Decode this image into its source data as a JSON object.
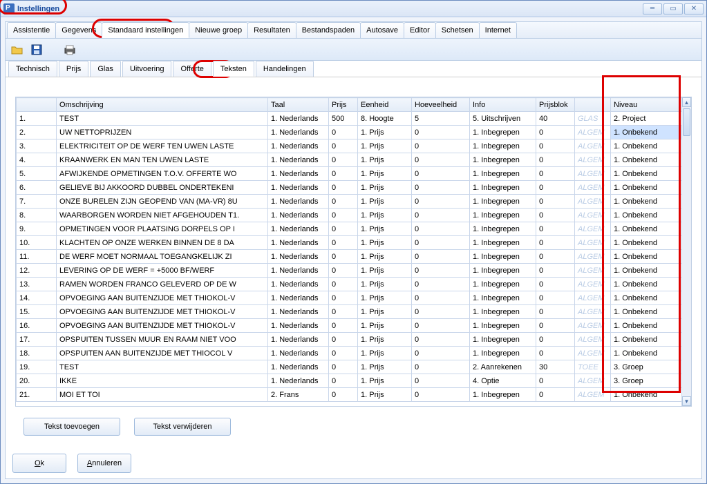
{
  "window": {
    "title": "Instellingen"
  },
  "main_tabs": [
    "Assistentie",
    "Gegevens",
    "Standaard instellingen",
    "Nieuwe groep",
    "Resultaten",
    "Bestandspaden",
    "Autosave",
    "Editor",
    "Schetsen",
    "Internet"
  ],
  "main_tabs_active_index": 2,
  "sub_tabs": [
    "Technisch",
    "Prijs",
    "Glas",
    "Uitvoering",
    "Offerte",
    "Teksten",
    "Handelingen"
  ],
  "sub_tabs_active_index": 5,
  "toolbar": {
    "open": "Open",
    "save": "Save",
    "print": "Print"
  },
  "columns": [
    "",
    "Omschrijving",
    "Taal",
    "Prijs",
    "Eenheid",
    "Hoeveelheid",
    "Info",
    "Prijsblok",
    "",
    "Niveau",
    ""
  ],
  "rows": [
    {
      "n": "1.",
      "desc": "TEST",
      "taal": "1. Nederlands",
      "prijs": "500",
      "eenh": "8. Hoogte",
      "hoev": "5",
      "info": "5. Uitschrijven",
      "pb": "40",
      "wm": "GLAS",
      "niv": "2. Project",
      "sel": false
    },
    {
      "n": "2.",
      "desc": "UW NETTOPRIJZEN",
      "taal": "1. Nederlands",
      "prijs": "0",
      "eenh": "1. Prijs",
      "hoev": "0",
      "info": "1. Inbegrepen",
      "pb": "0",
      "wm": "ALGEM",
      "niv": "1. Onbekend",
      "sel": true
    },
    {
      "n": "3.",
      "desc": "ELEKTRICITEIT OP DE WERF TEN UWEN LASTE",
      "taal": "1. Nederlands",
      "prijs": "0",
      "eenh": "1. Prijs",
      "hoev": "0",
      "info": "1. Inbegrepen",
      "pb": "0",
      "wm": "ALGEM",
      "niv": "1. Onbekend",
      "sel": false
    },
    {
      "n": "4.",
      "desc": "KRAANWERK EN MAN TEN UWEN LASTE",
      "taal": "1. Nederlands",
      "prijs": "0",
      "eenh": "1. Prijs",
      "hoev": "0",
      "info": "1. Inbegrepen",
      "pb": "0",
      "wm": "ALGEM",
      "niv": "1. Onbekend",
      "sel": false
    },
    {
      "n": "5.",
      "desc": "AFWIJKENDE OPMETINGEN T.O.V. OFFERTE WO",
      "taal": "1. Nederlands",
      "prijs": "0",
      "eenh": "1. Prijs",
      "hoev": "0",
      "info": "1. Inbegrepen",
      "pb": "0",
      "wm": "ALGEM",
      "niv": "1. Onbekend",
      "sel": false
    },
    {
      "n": "6.",
      "desc": "GELIEVE BIJ AKKOORD DUBBEL ONDERTEKENI",
      "taal": "1. Nederlands",
      "prijs": "0",
      "eenh": "1. Prijs",
      "hoev": "0",
      "info": "1. Inbegrepen",
      "pb": "0",
      "wm": "ALGEM",
      "niv": "1. Onbekend",
      "sel": false
    },
    {
      "n": "7.",
      "desc": "ONZE BURELEN ZIJN GEOPEND VAN (MA-VR) 8U",
      "taal": "1. Nederlands",
      "prijs": "0",
      "eenh": "1. Prijs",
      "hoev": "0",
      "info": "1. Inbegrepen",
      "pb": "0",
      "wm": "ALGEM",
      "niv": "1. Onbekend",
      "sel": false
    },
    {
      "n": "8.",
      "desc": "WAARBORGEN WORDEN NIET AFGEHOUDEN T1.",
      "taal": "1. Nederlands",
      "prijs": "0",
      "eenh": "1. Prijs",
      "hoev": "0",
      "info": "1. Inbegrepen",
      "pb": "0",
      "wm": "ALGEM",
      "niv": "1. Onbekend",
      "sel": false
    },
    {
      "n": "9.",
      "desc": "OPMETINGEN VOOR PLAATSING DORPELS OP I",
      "taal": "1. Nederlands",
      "prijs": "0",
      "eenh": "1. Prijs",
      "hoev": "0",
      "info": "1. Inbegrepen",
      "pb": "0",
      "wm": "ALGEM",
      "niv": "1. Onbekend",
      "sel": false
    },
    {
      "n": "10.",
      "desc": "KLACHTEN OP ONZE WERKEN BINNEN DE 8 DA",
      "taal": "1. Nederlands",
      "prijs": "0",
      "eenh": "1. Prijs",
      "hoev": "0",
      "info": "1. Inbegrepen",
      "pb": "0",
      "wm": "ALGEM",
      "niv": "1. Onbekend",
      "sel": false
    },
    {
      "n": "11.",
      "desc": "DE WERF MOET NORMAAL TOEGANGKELIJK ZI",
      "taal": "1. Nederlands",
      "prijs": "0",
      "eenh": "1. Prijs",
      "hoev": "0",
      "info": "1. Inbegrepen",
      "pb": "0",
      "wm": "ALGEM",
      "niv": "1. Onbekend",
      "sel": false
    },
    {
      "n": "12.",
      "desc": "LEVERING OP DE WERF = +5000 BF/WERF",
      "taal": "1. Nederlands",
      "prijs": "0",
      "eenh": "1. Prijs",
      "hoev": "0",
      "info": "1. Inbegrepen",
      "pb": "0",
      "wm": "ALGEM",
      "niv": "1. Onbekend",
      "sel": false
    },
    {
      "n": "13.",
      "desc": "RAMEN WORDEN FRANCO GELEVERD OP DE W",
      "taal": "1. Nederlands",
      "prijs": "0",
      "eenh": "1. Prijs",
      "hoev": "0",
      "info": "1. Inbegrepen",
      "pb": "0",
      "wm": "ALGEM",
      "niv": "1. Onbekend",
      "sel": false
    },
    {
      "n": "14.",
      "desc": "OPVOEGING AAN BUITENZIJDE MET THIOKOL-V",
      "taal": "1. Nederlands",
      "prijs": "0",
      "eenh": "1. Prijs",
      "hoev": "0",
      "info": "1. Inbegrepen",
      "pb": "0",
      "wm": "ALGEM",
      "niv": "1. Onbekend",
      "sel": false
    },
    {
      "n": "15.",
      "desc": "OPVOEGING AAN BUITENZIJDE MET THIOKOL-V",
      "taal": "1. Nederlands",
      "prijs": "0",
      "eenh": "1. Prijs",
      "hoev": "0",
      "info": "1. Inbegrepen",
      "pb": "0",
      "wm": "ALGEM",
      "niv": "1. Onbekend",
      "sel": false
    },
    {
      "n": "16.",
      "desc": "OPVOEGING AAN BUITENZIJDE MET THIOKOL-V",
      "taal": "1. Nederlands",
      "prijs": "0",
      "eenh": "1. Prijs",
      "hoev": "0",
      "info": "1. Inbegrepen",
      "pb": "0",
      "wm": "ALGEM",
      "niv": "1. Onbekend",
      "sel": false
    },
    {
      "n": "17.",
      "desc": "OPSPUITEN TUSSEN MUUR EN RAAM NIET VOO",
      "taal": "1. Nederlands",
      "prijs": "0",
      "eenh": "1. Prijs",
      "hoev": "0",
      "info": "1. Inbegrepen",
      "pb": "0",
      "wm": "ALGEM",
      "niv": "1. Onbekend",
      "sel": false
    },
    {
      "n": "18.",
      "desc": "OPSPUITEN AAN BUITENZIJDE MET THIOCOL V",
      "taal": "1. Nederlands",
      "prijs": "0",
      "eenh": "1. Prijs",
      "hoev": "0",
      "info": "1. Inbegrepen",
      "pb": "0",
      "wm": "ALGEM",
      "niv": "1. Onbekend",
      "sel": false
    },
    {
      "n": "19.",
      "desc": "TEST",
      "taal": "1. Nederlands",
      "prijs": "0",
      "eenh": "1. Prijs",
      "hoev": "0",
      "info": "2. Aanrekenen",
      "pb": "30",
      "wm": "TOEE",
      "niv": "3. Groep",
      "sel": false
    },
    {
      "n": "20.",
      "desc": "IKKE",
      "taal": "1. Nederlands",
      "prijs": "0",
      "eenh": "1. Prijs",
      "hoev": "0",
      "info": "4. Optie",
      "pb": "0",
      "wm": "ALGEM",
      "niv": "3. Groep",
      "sel": false
    },
    {
      "n": "21.",
      "desc": "MOI ET TOI",
      "taal": "2. Frans",
      "prijs": "0",
      "eenh": "1. Prijs",
      "hoev": "0",
      "info": "1. Inbegrepen",
      "pb": "0",
      "wm": "ALGEM",
      "niv": "1. Onbekend",
      "sel": false
    }
  ],
  "buttons": {
    "add": "Tekst toevoegen",
    "remove": "Tekst verwijderen",
    "ok": "Ok",
    "cancel": "Annuleren"
  }
}
